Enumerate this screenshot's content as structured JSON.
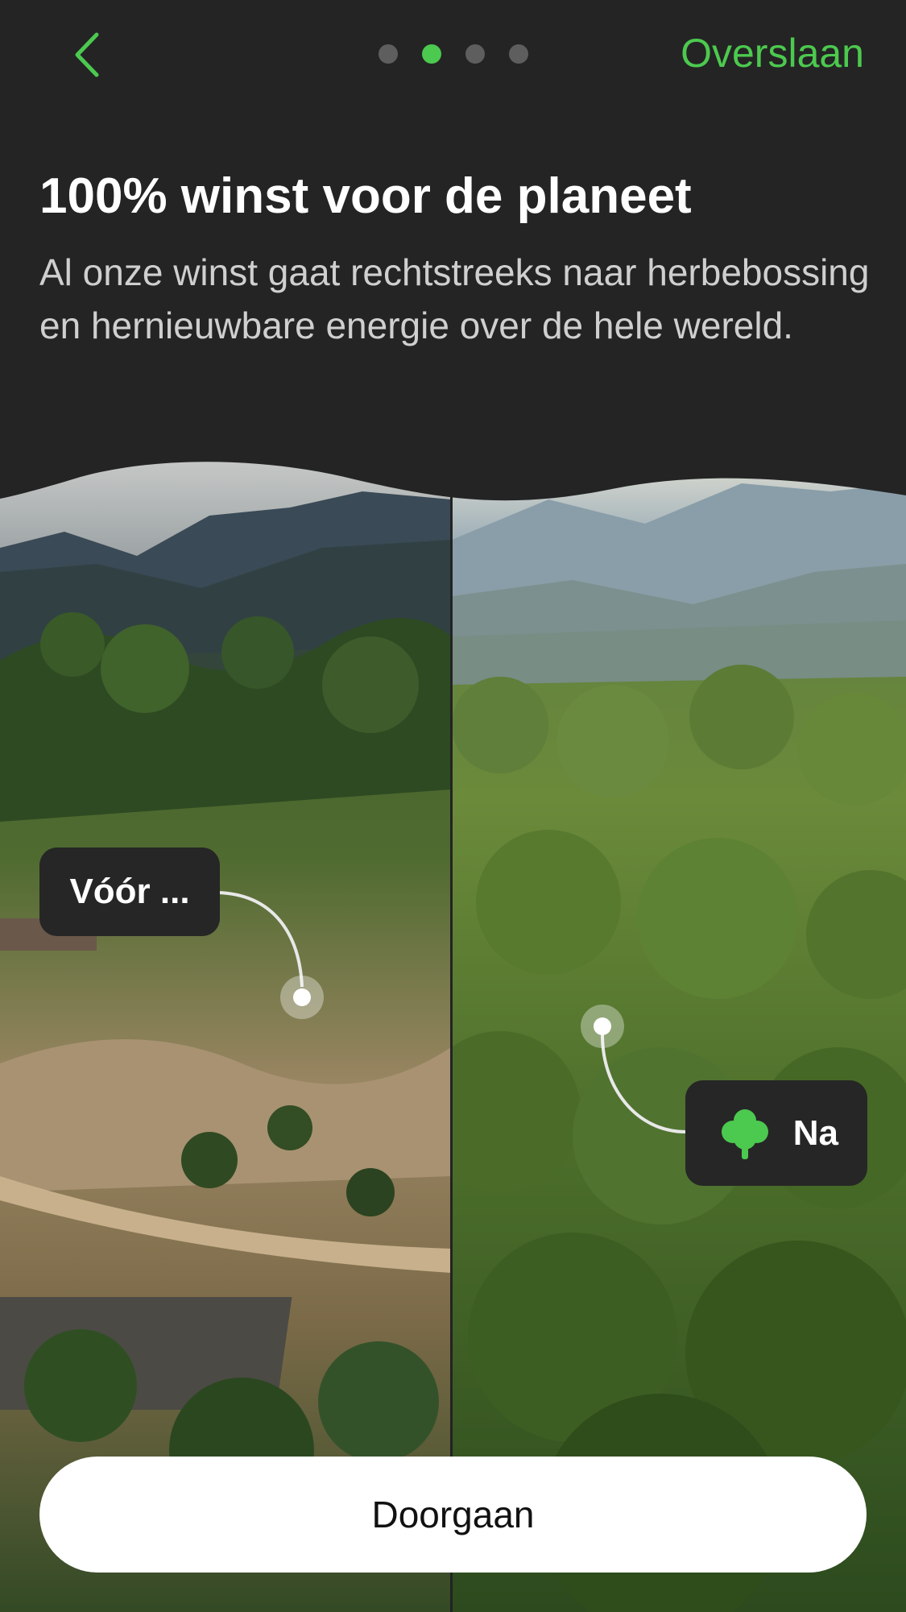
{
  "header": {
    "back_icon": "chevron-left-icon",
    "skip_label": "Overslaan",
    "pagination": {
      "total": 4,
      "active_index": 1
    }
  },
  "content": {
    "title": "100% winst voor de planeet",
    "subtitle": "Al onze winst gaat rechtstreeks naar herbebossing en hernieuwbare energie over de hele wereld."
  },
  "comparison": {
    "before_label": "Vóór ...",
    "after_label": "Na",
    "after_icon": "tree-icon"
  },
  "cta": {
    "label": "Doorgaan"
  },
  "colors": {
    "accent": "#4cc94f",
    "background": "#242424",
    "button": "#ffffff"
  }
}
